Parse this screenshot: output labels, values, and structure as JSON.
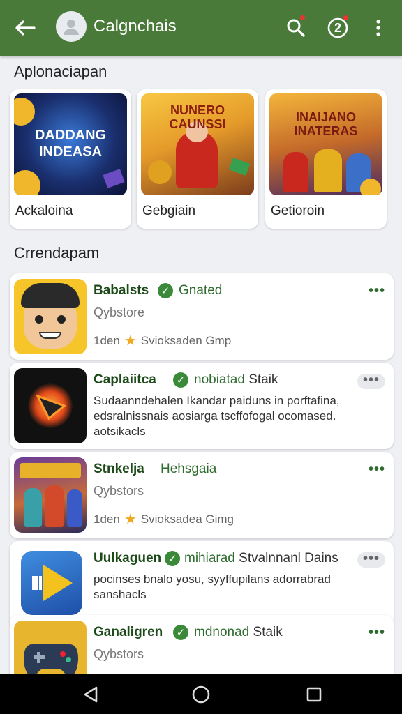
{
  "header": {
    "title": "Calgnchais",
    "badge_count": "2"
  },
  "featured": {
    "section_title": "Aplonaciapan",
    "items": [
      {
        "label": "Ackaloina",
        "art_text": "DADDANG INDEASA"
      },
      {
        "label": "Gebgiain",
        "art_text": "NUNERO CAUNSSI"
      },
      {
        "label": "Getioroin",
        "art_text": "INAIJANO INATERAS"
      }
    ]
  },
  "list": {
    "section_title": "Crrendapam",
    "items": [
      {
        "name": "Babalsts",
        "tag": "Gnated",
        "tag_dark": "",
        "sub": "Qybstore",
        "meta_left": "1den",
        "meta_right": "Svioksaden Gmp"
      },
      {
        "name": "Caplaiitca",
        "tag": "nobiatad",
        "tag_dark": "Staik",
        "desc": "Sudaanndehalen Ikandar paiduns in porftafina, edsralnissnais aosiarga tscffofogal ocomased. aotsikacls"
      },
      {
        "name": "Stnkelja",
        "tag": "Hehsgaia",
        "tag_dark": "",
        "sub": "Qybstors",
        "meta_left": "1den",
        "meta_right": "Svioksadea Gimg"
      },
      {
        "name": "Uulkaguen",
        "tag": "mihiarad",
        "tag_dark": "Stvalnnanl Dains",
        "desc": "pocinses bnalo yosu, syyffupilans adorrabrad sanshacls"
      },
      {
        "name": "Ganaligren",
        "tag": "mdnonad",
        "tag_dark": "Staik",
        "sub": "Qybstors"
      }
    ]
  },
  "colors": {
    "appbar": "#4a7a3a",
    "accent": "#2e6b2e",
    "star": "#f0a81d"
  }
}
